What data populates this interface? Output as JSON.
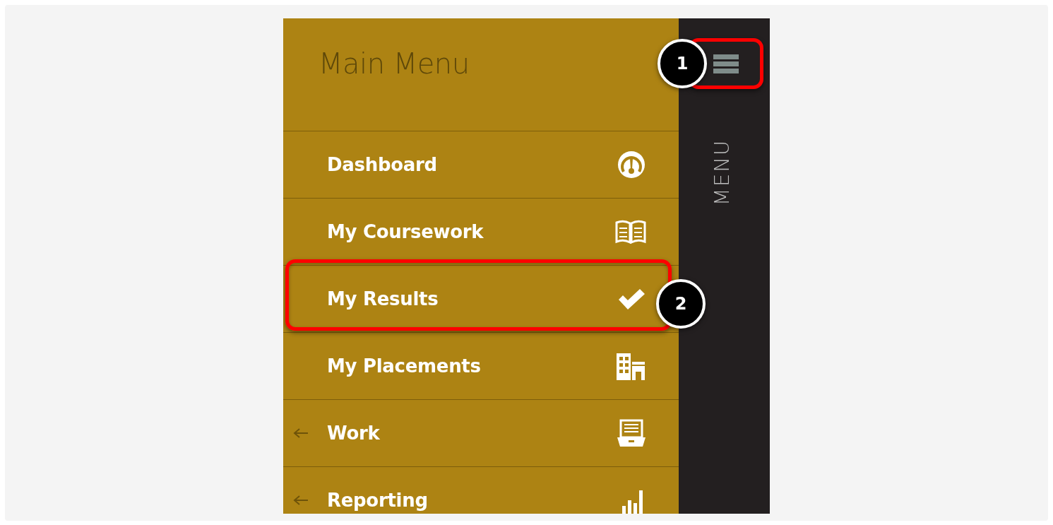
{
  "sidebar": {
    "title": "Main Menu",
    "menu_button": {
      "highlighted": true
    },
    "rail_label": "MENU",
    "items": [
      {
        "label": "Dashboard",
        "has_submenu": false,
        "highlighted": false
      },
      {
        "label": "My Coursework",
        "has_submenu": false,
        "highlighted": false
      },
      {
        "label": "My Results",
        "has_submenu": false,
        "highlighted": true
      },
      {
        "label": "My Placements",
        "has_submenu": false,
        "highlighted": false
      },
      {
        "label": "Work",
        "has_submenu": true,
        "highlighted": false
      },
      {
        "label": "Reporting",
        "has_submenu": true,
        "highlighted": false
      }
    ]
  },
  "annotations": [
    {
      "label": "1"
    },
    {
      "label": "2"
    }
  ]
}
